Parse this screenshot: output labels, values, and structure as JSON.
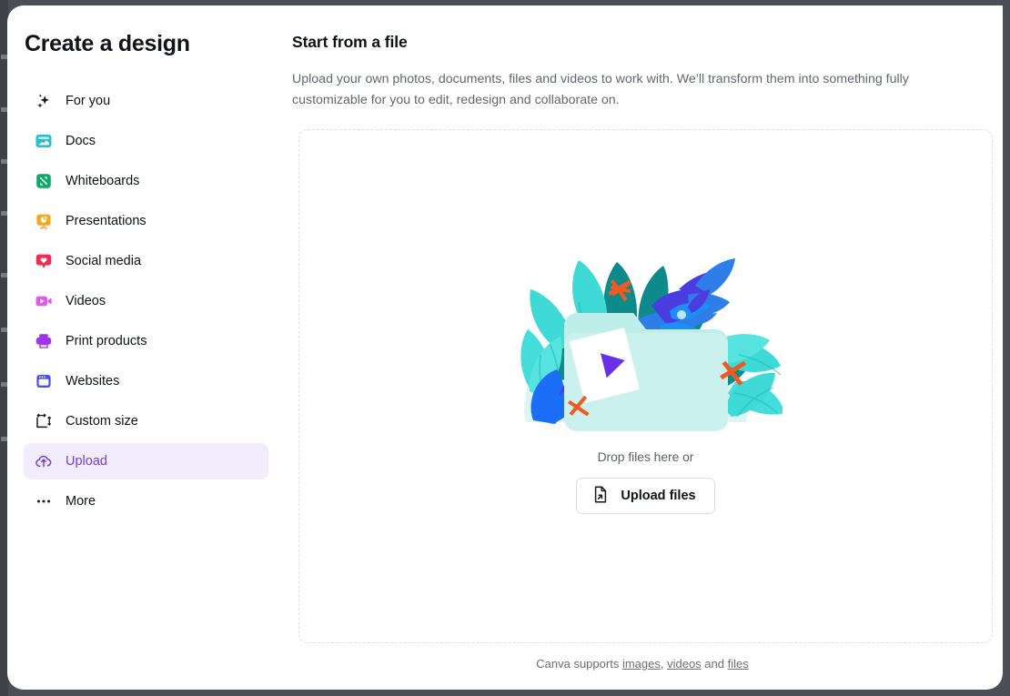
{
  "window": {
    "backdrop_color": "#4b4e57",
    "panel_background": "#ffffff"
  },
  "sidebar": {
    "title": "Create a design",
    "active_item": "Upload",
    "active_bg": "#f2ecfc",
    "active_fg": "#6f42d5",
    "items": [
      {
        "label": "For you",
        "icon": "sparkles-icon",
        "color": "#16181f"
      },
      {
        "label": "Docs",
        "icon": "docs-icon",
        "color": "#25bfd4"
      },
      {
        "label": "Whiteboards",
        "icon": "whiteboard-icon",
        "color": "#0fa76a"
      },
      {
        "label": "Presentations",
        "icon": "presentation-icon",
        "color": "#f5a623"
      },
      {
        "label": "Social media",
        "icon": "heart-bubble-icon",
        "color": "#f42b4c"
      },
      {
        "label": "Videos",
        "icon": "video-camera-icon",
        "color": "#e05ae8"
      },
      {
        "label": "Print products",
        "icon": "printer-icon",
        "color": "#a033f0"
      },
      {
        "label": "Websites",
        "icon": "browser-window-icon",
        "color": "#4a4df0"
      },
      {
        "label": "Custom size",
        "icon": "custom-size-icon",
        "color": "#16181f"
      },
      {
        "label": "Upload",
        "icon": "cloud-upload-icon",
        "color": "#6f42d5"
      },
      {
        "label": "More",
        "icon": "ellipsis-icon",
        "color": "#16181f"
      }
    ]
  },
  "main": {
    "heading": "Start from a file",
    "description": "Upload your own photos, documents, files and videos to work with. We’ll transform them into something fully customizable for you to edit, redesign and collaborate on.",
    "dropzone": {
      "illustration": "folder-with-media-illustration",
      "drop_text": "Drop files here or",
      "upload_button_label": "Upload files",
      "upload_button_icon": "file-upload-icon"
    },
    "footer": {
      "prefix": "Canva supports ",
      "link_images": "images",
      "separator_1": ", ",
      "link_videos": "videos",
      "separator_2": " and ",
      "link_files": "files"
    }
  }
}
